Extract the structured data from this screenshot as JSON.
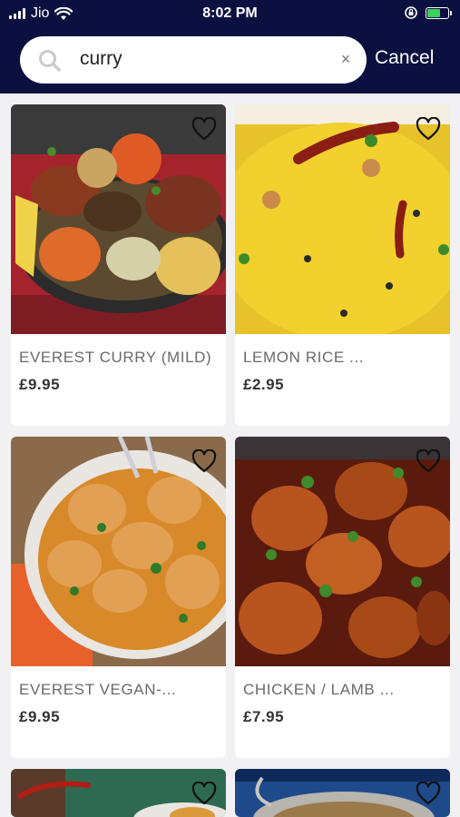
{
  "status": {
    "carrier": "Jio",
    "time": "8:02 PM"
  },
  "search": {
    "query": "curry",
    "clear_label": "×",
    "cancel_label": "Cancel"
  },
  "products": [
    {
      "name": "EVEREST CURRY (MILD)",
      "price": "£9.95",
      "favorite": false
    },
    {
      "name": "LEMON RICE ...",
      "price": "£2.95",
      "favorite": false
    },
    {
      "name": "EVEREST VEGAN-...",
      "price": "£9.95",
      "favorite": false
    },
    {
      "name": "CHICKEN / LAMB ...",
      "price": "£7.95",
      "favorite": false
    }
  ],
  "icons": {
    "search": "search-icon",
    "clear": "close-icon",
    "favorite": "heart-outline-icon",
    "wifi": "wifi-icon",
    "battery": "battery-charging-icon",
    "rotation_lock": "rotation-lock-icon"
  },
  "colors": {
    "header": "#0b1040",
    "background": "#f1f1f3",
    "battery_fill": "#3bd15a"
  }
}
